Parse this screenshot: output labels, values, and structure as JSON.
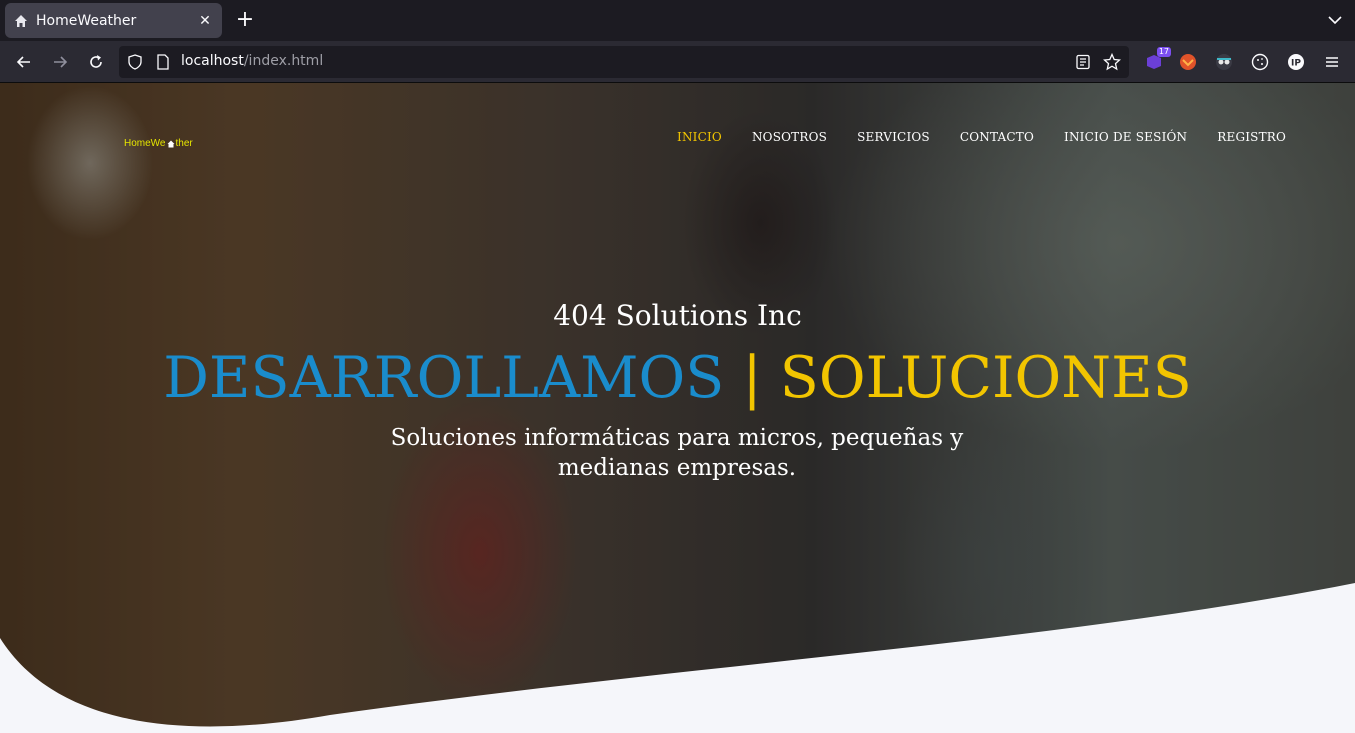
{
  "browser": {
    "tab_title": "HomeWeather",
    "url_host": "localhost",
    "url_path": "/index.html",
    "extension_badge": "17"
  },
  "site": {
    "logo_prefix": "HomeWe",
    "logo_suffix": "ther",
    "nav": [
      {
        "label": "INICIO",
        "active": true
      },
      {
        "label": "NOSOTROS",
        "active": false
      },
      {
        "label": "SERVICIOS",
        "active": false
      },
      {
        "label": "CONTACTO",
        "active": false
      },
      {
        "label": "INICIO DE SESIÓN",
        "active": false
      },
      {
        "label": "REGISTRO",
        "active": false
      }
    ]
  },
  "hero": {
    "company": "404 Solutions Inc",
    "title_part1": "DESARROLLAMOS",
    "title_separator": "|",
    "title_part2": "SOLUCIONES",
    "description": "Soluciones informáticas para micros, pequeñas y medianas empresas."
  },
  "colors": {
    "accent_blue": "#1a8ccc",
    "accent_yellow": "#f2c500",
    "curve_fill": "#f5f6fa"
  }
}
